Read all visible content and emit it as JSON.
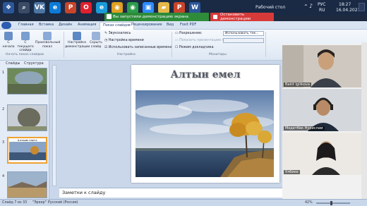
{
  "taskbar": {
    "icons": [
      {
        "name": "start-icon",
        "glyph": "❖",
        "color": "#2b579a"
      },
      {
        "name": "search-icon",
        "glyph": "⌕",
        "color": "#3b4b66"
      },
      {
        "name": "vk-icon",
        "glyph": "VK",
        "color": "#4c75a3"
      },
      {
        "name": "edge-icon",
        "glyph": "e",
        "color": "#0c7bd8"
      },
      {
        "name": "powerpoint-icon",
        "glyph": "P",
        "color": "#c8452a"
      },
      {
        "name": "opera-icon",
        "glyph": "O",
        "color": "#e0202c"
      },
      {
        "name": "edge2-icon",
        "glyph": "e",
        "color": "#1a9bd8"
      },
      {
        "name": "chrome-icon",
        "glyph": "◉",
        "color": "#e0a020"
      },
      {
        "name": "chrome2-icon",
        "glyph": "◉",
        "color": "#2c9c4a"
      },
      {
        "name": "zoom-icon",
        "glyph": "▣",
        "color": "#2d8cff"
      },
      {
        "name": "folder-icon",
        "glyph": "▰",
        "color": "#e6b84a"
      },
      {
        "name": "powerpoint2-icon",
        "glyph": "P",
        "color": "#c8452a"
      },
      {
        "name": "word-icon",
        "glyph": "W",
        "color": "#2b579a"
      }
    ],
    "desktop_label": "Рабочий стол",
    "lang": "РУС",
    "region": "RU",
    "time": "18:27",
    "date": "16.04.2021"
  },
  "share": {
    "notice": "Вы запустили демонстрацию экрана",
    "stop_label": "Остановить демонстрацию"
  },
  "ribbon_tabs": [
    "Главная",
    "Вставка",
    "Дизайн",
    "Анимация",
    "Показ слайдов",
    "Рецензирование",
    "Вид",
    "Foxit PDF"
  ],
  "ribbon": {
    "start_group": {
      "buttons": [
        "С начала",
        "С текущего слайда",
        "Произвольный показ"
      ],
      "label": "Начать показ слайдов"
    },
    "setup_group": {
      "buttons": [
        "Настройка демонстрации",
        "Скрыть слайд"
      ],
      "checks": [
        "Звукозапись",
        "Настройка времени",
        "Использовать записанные времена"
      ],
      "label": "Настройка"
    },
    "monitors_group": {
      "resolution_label": "Разрешение:",
      "resolution_value": "Использовать тек...",
      "show_on_label": "Показать презентацию на:",
      "presenter_view": "Режим докладчика",
      "label": "Мониторы"
    }
  },
  "slide_panel": {
    "tabs": [
      "Слайды",
      "Структура"
    ],
    "thumbs": [
      "1",
      "2",
      "3",
      "4"
    ],
    "selected": "3",
    "thumb3_title": "Алтын емел"
  },
  "slide": {
    "title": "Алтын емел"
  },
  "notes_placeholder": "Заметки к слайду",
  "status": {
    "slide_info": "Слайд 7 из 33",
    "theme": "\"Эркер\"",
    "language": "Русский (Россия)",
    "zoom": "42%"
  },
  "participants": [
    {
      "name": "Bakit Igilikova"
    },
    {
      "name": "Медетбек Нурислам"
    },
    {
      "name": "Улбике"
    }
  ]
}
